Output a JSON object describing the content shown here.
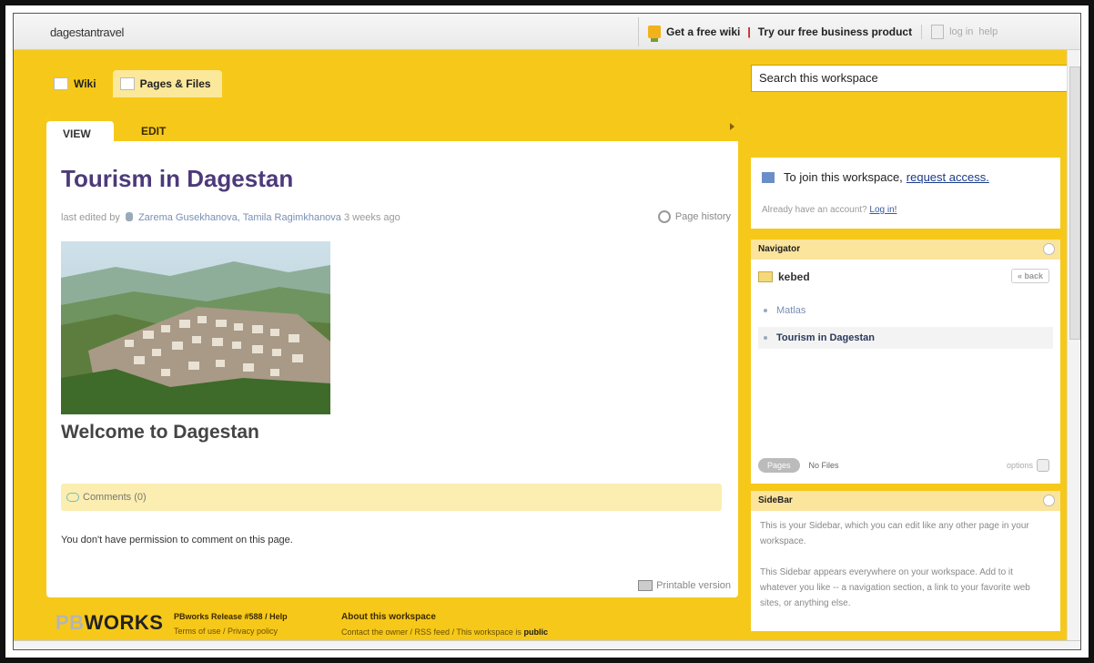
{
  "header": {
    "site_name": "dagestantravel",
    "get_free_wiki": "Get a free wiki",
    "separator": "|",
    "try_business": "Try our free business product",
    "log_in": "log in",
    "help": "help"
  },
  "tabs": [
    {
      "label": "Wiki",
      "icon": "page-icon"
    },
    {
      "label": "Pages & Files",
      "icon": "pages-files-icon"
    }
  ],
  "search": {
    "placeholder": "Search this workspace"
  },
  "page": {
    "view_tab": "VIEW",
    "edit_tab": "EDIT",
    "title": "Tourism in Dagestan",
    "last_edited_prefix": "last edited by",
    "editors": "Zarema Gusekhanova, Tamila Ragimkhanova",
    "edited_time": "3 weeks ago",
    "page_history": "Page history",
    "welcome_heading": "Welcome to Dagestan",
    "comments": "Comments (0)",
    "no_permission": "You don't have permission to comment on this page.",
    "printable": "Printable version"
  },
  "footer": {
    "logo_pb": "PB",
    "logo_works": "WORKS",
    "release": "PBworks Release #588 / Help",
    "terms": "Terms of use / Privacy policy",
    "about": "About this workspace",
    "contact": "Contact the owner / RSS feed / This workspace is",
    "public": "public"
  },
  "join": {
    "title": "To join this workspace,",
    "link": "request access.",
    "already": "Already have an account?",
    "login": "Log in!"
  },
  "navigator": {
    "title": "Navigator",
    "folder": "kebed",
    "back": "« back",
    "items": [
      {
        "label": "Matlas"
      },
      {
        "label": "Tourism in Dagestan"
      }
    ],
    "pages_pill": "Pages",
    "no_files": "No Files",
    "options": "options"
  },
  "sidebar": {
    "title": "SideBar",
    "text1": "This is your Sidebar, which you can edit like any other page in your workspace.",
    "text2": "This Sidebar appears everywhere on your workspace. Add to it whatever you like -- a navigation section, a link to your favorite web sites, or anything else."
  },
  "colors": {
    "accent_yellow": "#f6c81a",
    "title_purple": "#4d3a7a",
    "link_blue": "#1a3a8a"
  }
}
